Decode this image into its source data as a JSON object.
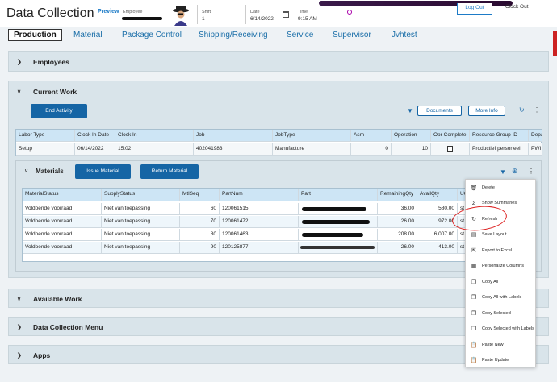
{
  "header": {
    "title": "Data Collection",
    "preview": "Preview",
    "employee_label": "Employee",
    "shift_label": "Shift",
    "shift_value": "1",
    "date_label": "Date",
    "date_value": "6/14/2022",
    "time_label": "Time",
    "time_value": "9:15 AM",
    "logout": "Log Out",
    "clockout": "Clock Out"
  },
  "tabs": [
    "Production",
    "Material",
    "Package Control",
    "Shipping/Receiving",
    "Service",
    "Supervisor",
    "Jvhtest"
  ],
  "panels": {
    "employees": "Employees",
    "current_work": "Current Work",
    "available_work": "Available Work",
    "dc_menu": "Data Collection Menu",
    "apps": "Apps"
  },
  "current_work": {
    "end_activity": "End Activity",
    "documents": "Documents",
    "more_info": "More Info",
    "columns": [
      "Labor Type",
      "Clock In Date",
      "Clock In",
      "Job",
      "JobType",
      "Asm",
      "Operation",
      "Opr Complete",
      "Resource Group ID",
      "Depa"
    ],
    "row": [
      "Setup",
      "06/14/2022",
      "15:02",
      "402041983",
      "Manufacture",
      "0",
      "10",
      "",
      "Productief personeel",
      "PWI"
    ]
  },
  "materials": {
    "title": "Materials",
    "issue": "Issue Material",
    "return": "Return Material",
    "columns": [
      "MaterialStatus",
      "SupplyStatus",
      "MtlSeq",
      "PartNum",
      "Part",
      "RemainingQty",
      "AvailQty",
      "UO"
    ],
    "rows": [
      [
        "Voldoende voorraad",
        "Niet van toepassing",
        "60",
        "120061515",
        "",
        "36.00",
        "580.00",
        "st"
      ],
      [
        "Voldoende voorraad",
        "Niet van toepassing",
        "70",
        "120061472",
        "",
        "26.00",
        "972.00",
        "st"
      ],
      [
        "Voldoende voorraad",
        "Niet van toepassing",
        "80",
        "120061463",
        "",
        "208.00",
        "6,007.00",
        "st"
      ],
      [
        "Voldoende voorraad",
        "Niet van toepassing",
        "90",
        "120125877",
        "",
        "26.00",
        "413.00",
        "st"
      ]
    ]
  },
  "context_menu": [
    {
      "label": "Delete",
      "icon": "trash-icon"
    },
    {
      "label": "Show Summaries",
      "icon": "sigma-icon"
    },
    {
      "label": "Refresh",
      "icon": "refresh-icon"
    },
    {
      "label": "Save Layout",
      "icon": "save-icon"
    },
    {
      "label": "Export to Excel",
      "icon": "export-icon"
    },
    {
      "label": "Personalize Columns",
      "icon": "columns-icon"
    },
    {
      "label": "Copy All",
      "icon": "copy-icon"
    },
    {
      "label": "Copy All with Labels",
      "icon": "copy-icon"
    },
    {
      "label": "Copy Selected",
      "icon": "copy-icon"
    },
    {
      "label": "Copy Selected with Labels",
      "icon": "copy-icon"
    },
    {
      "label": "Paste New",
      "icon": "paste-icon"
    },
    {
      "label": "Paste Update",
      "icon": "paste-icon"
    }
  ],
  "colors": {
    "accent": "#1565a5",
    "panel": "#d9e4ea",
    "grid_header": "#cde5f5",
    "highlight": "#dd2222"
  }
}
